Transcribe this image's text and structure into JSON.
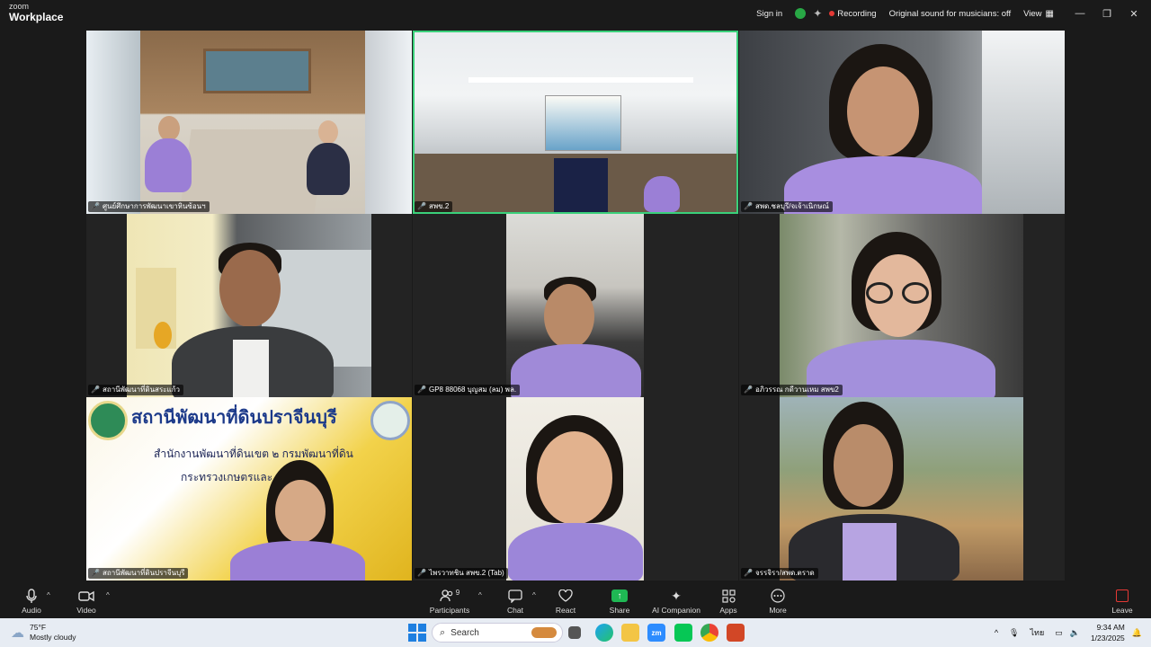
{
  "app": {
    "brand_line1": "zoom",
    "brand_line2": "Workplace"
  },
  "titlebar": {
    "sign_in": "Sign in",
    "recording": "Recording",
    "original_sound": "Original sound for musicians: off",
    "view": "View",
    "min": "—",
    "restore": "❐",
    "close": "✕"
  },
  "tiles": [
    {
      "name": "ศูนย์ศึกษาการพัฒนาเขาหินซ้อนฯ"
    },
    {
      "name": "สพข.2"
    },
    {
      "name": "สพด.ชลบุรี/จเจ้าเนิกษณ์"
    },
    {
      "name": "สถานีพัฒนาที่ดินสระแก้ว"
    },
    {
      "name": "GP8 88068 บุญสม (ลม) พล."
    },
    {
      "name": "อภิวรรณ กดีวานเหม สพข2"
    },
    {
      "name": "สถานีพัฒนาที่ดินปราจีนบุรี"
    },
    {
      "name": "ไพรวาทชิน สพข.2 (Tab)"
    },
    {
      "name": "จรรจิรา/สพด.ตราด"
    }
  ],
  "banner": {
    "title": "สถานีพัฒนาที่ดินปราจีนบุรี",
    "line2": "สำนักงานพัฒนาที่ดินเขต ๒  กรมพัฒนาที่ดิน",
    "line3": "กระทรวงเกษตรและ"
  },
  "toolbar": {
    "audio": "Audio",
    "video": "Video",
    "participants": "Participants",
    "participants_count": "9",
    "chat": "Chat",
    "react": "React",
    "share": "Share",
    "ai": "AI Companion",
    "apps": "Apps",
    "more": "More",
    "leave": "Leave"
  },
  "taskbar": {
    "temp": "75°F",
    "weather": "Mostly cloudy",
    "search_placeholder": "Search",
    "lang": "ไทย",
    "time": "9:34 AM",
    "date": "1/23/2025"
  },
  "colors": {
    "active_border": "#3ad07a",
    "share_green": "#1fb854",
    "mic_off_red": "#e53935",
    "uniform_purple": "#9b7fd6"
  }
}
